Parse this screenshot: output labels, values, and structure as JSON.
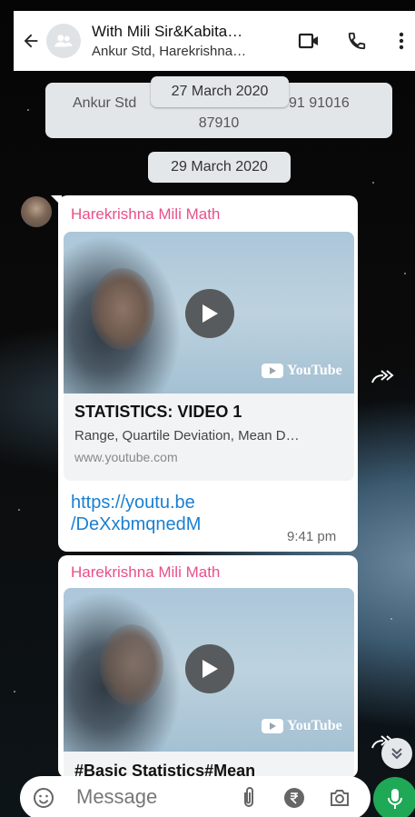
{
  "header": {
    "title": "With Mili Sir&Kabita…",
    "subtitle": "Ankur Std, Harekrishna…"
  },
  "system_message": {
    "line1": "Ankur Std",
    "line1_right": "91 91016",
    "line2": "87910"
  },
  "dates": {
    "first": "27 March 2020",
    "second": "29 March 2020"
  },
  "messages": [
    {
      "sender": "Harekrishna Mili Math",
      "preview": {
        "brand": "YouTube",
        "title": "STATISTICS: VIDEO 1",
        "description": "Range, Quartile Deviation, Mean D…",
        "domain": "www.youtube.com"
      },
      "link_line1": "https://youtu.be",
      "link_line2": "/DeXxbmqnedM",
      "time": "9:41 pm"
    },
    {
      "sender": "Harekrishna Mili Math",
      "preview": {
        "brand": "YouTube",
        "title": "#Basic Statistics#Mean"
      }
    }
  ],
  "input": {
    "placeholder": "Message"
  },
  "colors": {
    "sender": "#e94f89",
    "link": "#1a7fd1",
    "mic_button": "#1fa855"
  }
}
